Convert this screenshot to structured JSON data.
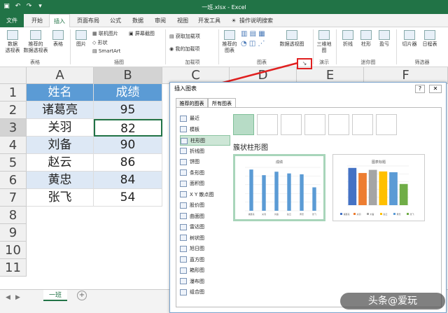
{
  "window": {
    "title": "一班.xlsx - Excel"
  },
  "tabs": [
    "文件",
    "开始",
    "插入",
    "页面布局",
    "公式",
    "数据",
    "审阅",
    "视图",
    "开发工具",
    "操作说明搜索"
  ],
  "ribbon": {
    "pivot": "数据\n透视表",
    "recpivot": "推荐的\n数据透视表",
    "table": "表格",
    "group_table": "表格",
    "picture": "图片",
    "online_pic": "联机图片",
    "shapes": "形状",
    "smartart": "SmartArt",
    "screenshot": "屏幕截图",
    "group_illus": "插图",
    "get_addins": "获取加载项",
    "my_addins": "我的加载项",
    "group_addins": "加载项",
    "rec_charts": "推荐的\n图表",
    "pivotchart": "数据透视图",
    "group_charts": "图表",
    "map3d": "三维地\n图",
    "group_tours": "演示",
    "line": "折线",
    "column": "柱形",
    "winloss": "盈亏",
    "group_spark": "迷你图",
    "slicer": "切片器",
    "timeline": "日程表",
    "group_filter": "筛选器"
  },
  "sheet": {
    "columns": [
      "A",
      "B",
      "C",
      "D",
      "E",
      "F"
    ],
    "rows": [
      "1",
      "2",
      "3",
      "4",
      "5",
      "6",
      "7",
      "8",
      "9",
      "10",
      "11"
    ],
    "header": [
      "姓名",
      "成绩"
    ],
    "data": [
      [
        "诸葛亮",
        "95"
      ],
      [
        "关羽",
        "82"
      ],
      [
        "刘备",
        "90"
      ],
      [
        "赵云",
        "86"
      ],
      [
        "黄忠",
        "84"
      ],
      [
        "张飞",
        "54"
      ]
    ],
    "tab": "一班"
  },
  "dialog": {
    "title": "插入图表",
    "help": "?",
    "close": "✕",
    "tabs": [
      "推荐的图表",
      "所有图表"
    ],
    "types": [
      "最近",
      "模板",
      "柱形图",
      "折线图",
      "饼图",
      "条形图",
      "面积图",
      "X Y 散点图",
      "股价图",
      "曲面图",
      "雷达图",
      "树状图",
      "旭日图",
      "直方图",
      "箱形图",
      "瀑布图",
      "组合图"
    ],
    "subtype_title": "簇状柱形图",
    "thumb1_title": "成绩",
    "thumb2_title": "图表标题"
  },
  "chart_data": [
    {
      "type": "bar",
      "title": "成绩",
      "categories": [
        "诸葛亮",
        "关羽",
        "刘备",
        "赵云",
        "黄忠",
        "张飞"
      ],
      "values": [
        95,
        82,
        90,
        86,
        84,
        54
      ],
      "ylim": [
        0,
        100
      ]
    },
    {
      "type": "bar",
      "title": "图表标题",
      "series": [
        {
          "name": "诸葛亮",
          "values": [
            95
          ]
        },
        {
          "name": "关羽",
          "values": [
            82
          ]
        },
        {
          "name": "刘备",
          "values": [
            90
          ]
        },
        {
          "name": "赵云",
          "values": [
            86
          ]
        },
        {
          "name": "黄忠",
          "values": [
            84
          ]
        },
        {
          "name": "张飞",
          "values": [
            54
          ]
        }
      ],
      "colors": [
        "#4472c4",
        "#ed7d31",
        "#a5a5a5",
        "#ffc000",
        "#5b9bd5",
        "#70ad47"
      ],
      "ylim": [
        0,
        100
      ]
    }
  ],
  "watermark": "头条@爱玩"
}
